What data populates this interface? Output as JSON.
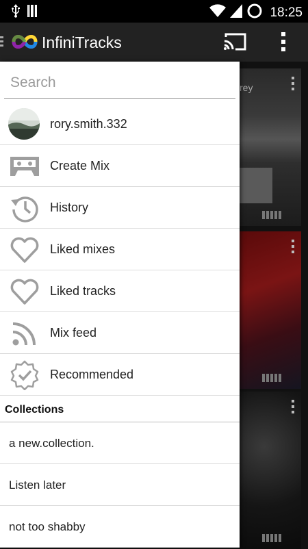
{
  "status_bar": {
    "time": "18:25",
    "icons": [
      "usb-icon",
      "barcode-icon",
      "wifi-icon",
      "signal-icon",
      "sync-icon"
    ]
  },
  "app_bar": {
    "title": "InfiniTracks",
    "icons": [
      "logo-icon",
      "cast-icon",
      "more-vert-icon"
    ]
  },
  "drawer": {
    "search_placeholder": "Search",
    "user": {
      "name": "rory.smith.332",
      "icon": "avatar"
    },
    "menu": [
      {
        "label": "Create Mix",
        "icon": "cassette-icon"
      },
      {
        "label": "History",
        "icon": "history-icon"
      },
      {
        "label": "Liked mixes",
        "icon": "heart-icon"
      },
      {
        "label": "Liked tracks",
        "icon": "heart-icon"
      },
      {
        "label": "Mix feed",
        "icon": "rss-icon"
      },
      {
        "label": "Recommended",
        "icon": "verified-badge-icon"
      }
    ],
    "collections_header": "Collections",
    "collections": [
      "a new.collection.",
      "Listen later",
      "not too shabby"
    ]
  },
  "background": {
    "card_caption_fragment": "rey"
  },
  "colors": {
    "status_bar": "#000000",
    "app_bar": "#222222",
    "drawer_bg": "#ffffff",
    "icon_gray": "#9e9e9e"
  }
}
